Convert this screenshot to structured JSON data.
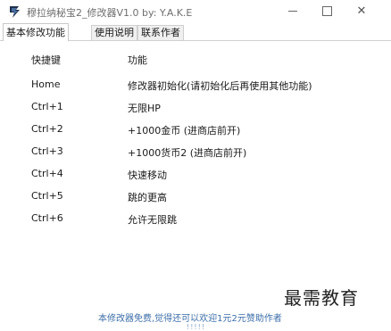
{
  "window": {
    "title": "穆拉纳秘宝2_修改器V1.0 by: Y.A.K.E",
    "minimize": "—",
    "close": "✕"
  },
  "tabs": [
    {
      "label": "基本修改功能",
      "active": true
    },
    {
      "label": "使用说明",
      "active": false
    },
    {
      "label": "联系作者",
      "active": false
    }
  ],
  "table": {
    "header_key": "快捷键",
    "header_func": "功能",
    "rows": [
      {
        "key": "Home",
        "func": "修改器初始化(请初始化后再使用其他功能)"
      },
      {
        "key": "Ctrl+1",
        "func": "无限HP"
      },
      {
        "key": "Ctrl+2",
        "func": "+1000金币 (进商店前开)"
      },
      {
        "key": "Ctrl+3",
        "func": "+1000货币2 (进商店前开)"
      },
      {
        "key": "Ctrl+4",
        "func": "快速移动"
      },
      {
        "key": "Ctrl+5",
        "func": "跳的更高"
      },
      {
        "key": "Ctrl+6",
        "func": "允许无限跳"
      }
    ]
  },
  "footer": {
    "note": "本修改器免费,觉得还可以欢迎1元2元赞助作者",
    "dots": "!!!!!"
  },
  "watermark": "最需教育",
  "colors": {
    "link": "#3c6ea8",
    "tab_border": "#cfcfcf"
  }
}
